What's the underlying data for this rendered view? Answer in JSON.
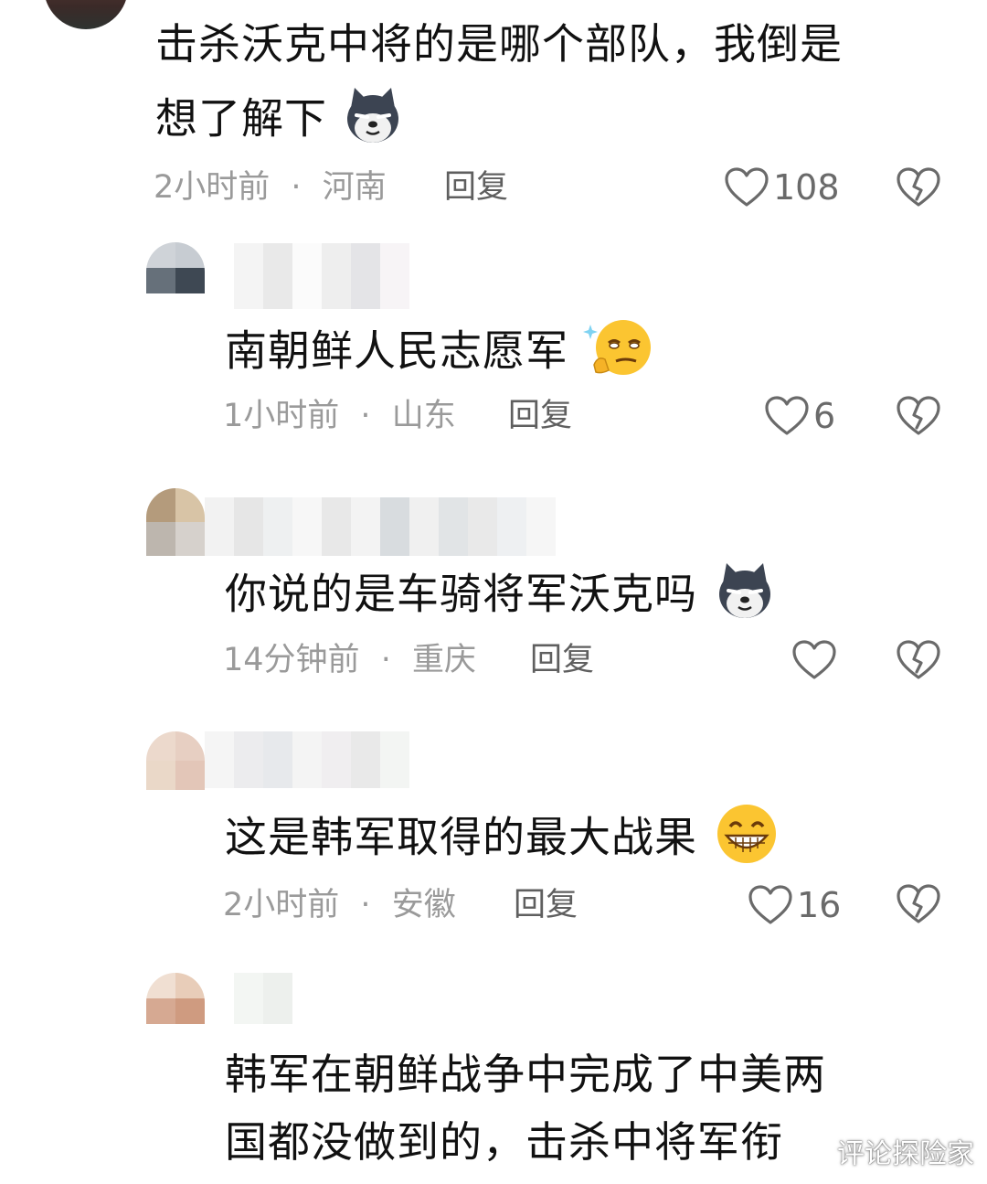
{
  "comments": [
    {
      "text_line1": "击杀沃克中将的是哪个部队，我倒是",
      "text_line2": "想了解下",
      "emoji": "dog-emoji",
      "time": "2小时前",
      "location": "河南",
      "reply_label": "回复",
      "likes": "108"
    },
    {
      "text": "南朝鲜人民志愿军",
      "emoji": "thinking-smirk-emoji",
      "time": "1小时前",
      "location": "山东",
      "reply_label": "回复",
      "likes": "6"
    },
    {
      "text": "你说的是车骑将军沃克吗",
      "emoji": "dog-emoji",
      "time": "14分钟前",
      "location": "重庆",
      "reply_label": "回复",
      "likes": ""
    },
    {
      "text": "这是韩军取得的最大战果",
      "emoji": "grin-emoji",
      "time": "2小时前",
      "location": "安徽",
      "reply_label": "回复",
      "likes": "16"
    },
    {
      "text_line1": "韩军在朝鲜战争中完成了中美两",
      "text_line2": "国都没做到的，击杀中将军衔"
    }
  ],
  "meta_separator": "·",
  "watermark": "评论探险家",
  "colors": {
    "text": "#111111",
    "meta": "#9a9a9a",
    "icon": "#6a6a6a",
    "background": "#ffffff"
  }
}
